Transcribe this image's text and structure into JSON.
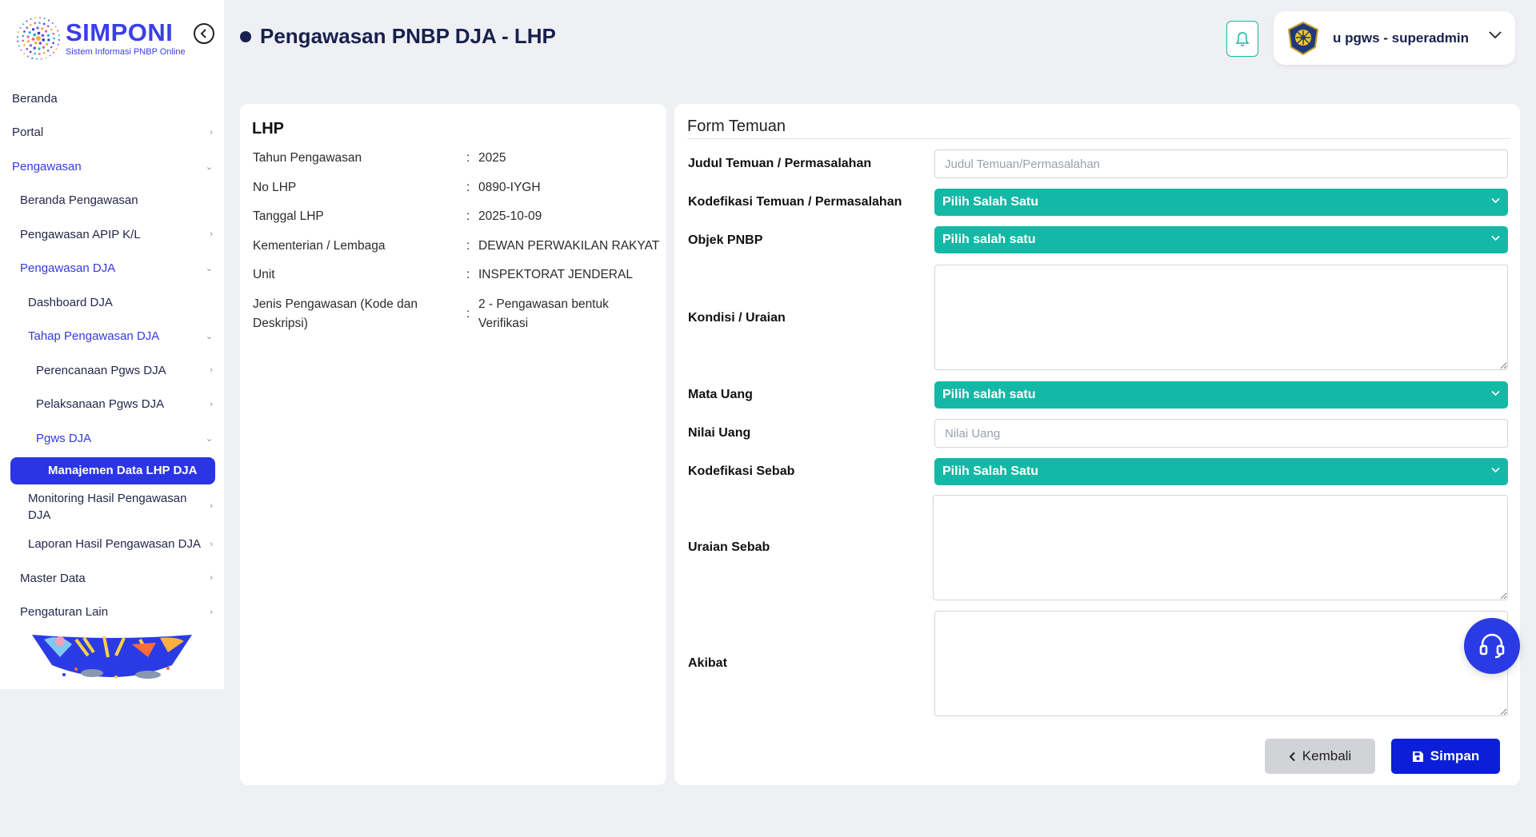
{
  "app": {
    "logo_title": "SIMPONI",
    "logo_subtitle": "Sistem Informasi PNBP Online"
  },
  "header": {
    "page_title": "Pengawasan PNBP DJA - LHP",
    "user_name": "u pgws - superadmin"
  },
  "sidebar": {
    "items": [
      {
        "label": "Beranda"
      },
      {
        "label": "Portal"
      },
      {
        "label": "Pengawasan"
      },
      {
        "label": "Beranda Pengawasan"
      },
      {
        "label": "Pengawasan APIP K/L"
      },
      {
        "label": "Pengawasan DJA"
      },
      {
        "label": "Dashboard DJA"
      },
      {
        "label": "Tahap Pengawasan DJA"
      },
      {
        "label": "Perencanaan Pgws DJA"
      },
      {
        "label": "Pelaksanaan Pgws DJA"
      },
      {
        "label": "Pgws DJA"
      },
      {
        "label": "Manajemen Data LHP DJA"
      },
      {
        "label": "Monitoring Hasil Pengawasan DJA"
      },
      {
        "label": "Laporan Hasil Pengawasan DJA"
      },
      {
        "label": "Master Data"
      },
      {
        "label": "Pengaturan Lain"
      }
    ]
  },
  "lhp": {
    "heading": "LHP",
    "rows": [
      {
        "label": "Tahun Pengawasan",
        "value": "2025"
      },
      {
        "label": "No LHP",
        "value": "0890-IYGH"
      },
      {
        "label": "Tanggal LHP",
        "value": "2025-10-09"
      },
      {
        "label": "Kementerian / Lembaga",
        "value": "DEWAN PERWAKILAN RAKYAT"
      },
      {
        "label": "Unit",
        "value": "INSPEKTORAT JENDERAL"
      },
      {
        "label": "Jenis Pengawasan (Kode dan Deskripsi)",
        "value": "2 - Pengawasan bentuk Verifikasi"
      }
    ],
    "separator": ":"
  },
  "form": {
    "title": "Form Temuan",
    "judul": {
      "label": "Judul Temuan / Permasalahan",
      "placeholder": "Judul Temuan/Permasalahan",
      "value": ""
    },
    "kodefikasi_temuan": {
      "label": "Kodefikasi Temuan / Permasalahan",
      "selected": "Pilih Salah Satu"
    },
    "objek_pnbp": {
      "label": "Objek PNBP",
      "selected": "Pilih salah satu"
    },
    "kondisi": {
      "label": "Kondisi / Uraian",
      "value": ""
    },
    "mata_uang": {
      "label": "Mata Uang",
      "selected": "Pilih salah satu"
    },
    "nilai_uang": {
      "label": "Nilai Uang",
      "placeholder": "Nilai Uang",
      "value": ""
    },
    "kodefikasi_sebab": {
      "label": "Kodefikasi Sebab",
      "selected": "Pilih Salah Satu"
    },
    "uraian_sebab": {
      "label": "Uraian Sebab",
      "value": ""
    },
    "akibat": {
      "label": "Akibat",
      "value": ""
    },
    "back_label": "Kembali",
    "save_label": "Simpan"
  },
  "colors": {
    "brand": "#3a3ee8",
    "teal": "#14b8a6",
    "primary_button": "#0b1fd8",
    "active_nav": "#2b35e5"
  }
}
